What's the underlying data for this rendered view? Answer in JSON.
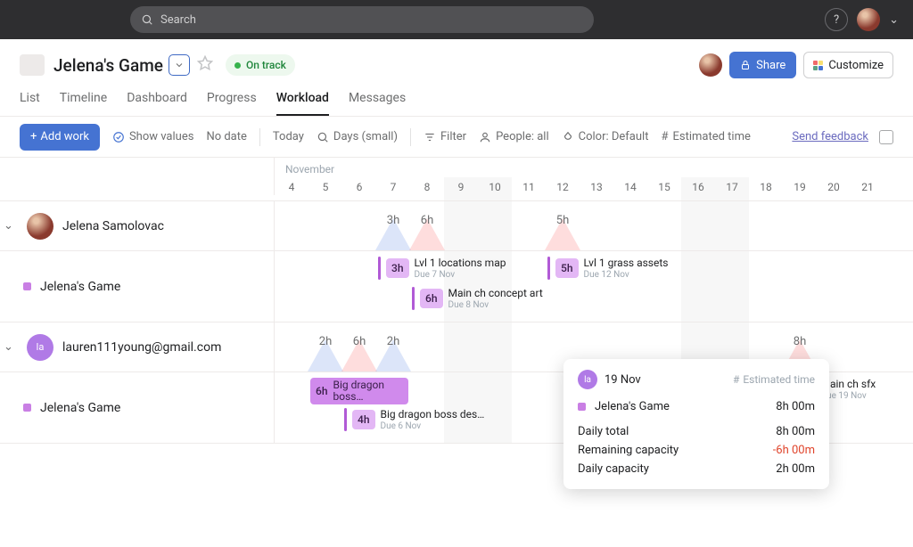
{
  "search": {
    "placeholder": "Search"
  },
  "header": {
    "title": "Jelena's Game",
    "status_label": "On track",
    "share_label": "Share",
    "customize_label": "Customize"
  },
  "tabs": [
    "List",
    "Timeline",
    "Dashboard",
    "Progress",
    "Workload",
    "Messages"
  ],
  "active_tab": 4,
  "toolbar": {
    "add_work": "Add work",
    "show_values": "Show values",
    "no_date": "No date",
    "today": "Today",
    "zoom": "Days (small)",
    "filter": "Filter",
    "people": "People: all",
    "color": "Color: Default",
    "estimate": "Estimated time",
    "feedback": "Send feedback"
  },
  "month": "November",
  "days": [
    "4",
    "5",
    "6",
    "7",
    "8",
    "9",
    "10",
    "11",
    "12",
    "13",
    "14",
    "15",
    "16",
    "17",
    "18",
    "19",
    "20",
    "21"
  ],
  "weekend_indices": [
    5,
    6,
    12,
    13
  ],
  "people": [
    {
      "name": "Jelena Samolovac",
      "avatar": "photo",
      "hours": [
        {
          "day": 7,
          "h": "3h",
          "peak": "blue"
        },
        {
          "day": 8,
          "h": "6h",
          "peak": "red"
        },
        {
          "day": 12,
          "h": "5h",
          "peak": "red"
        }
      ],
      "project_label": "Jelena's Game",
      "tasks": [
        {
          "kind": "card",
          "day": 7,
          "row": 0,
          "hours": "3h",
          "title": "Lvl 1 locations map",
          "due": "Due 7 Nov"
        },
        {
          "kind": "card",
          "day": 12,
          "row": 0,
          "hours": "5h",
          "title": "Lvl 1 grass assets",
          "due": "Due 12 Nov"
        },
        {
          "kind": "card",
          "day": 8,
          "row": 1,
          "hours": "6h",
          "title": "Main ch concept art",
          "due": "Due 8 Nov"
        }
      ]
    },
    {
      "name": "lauren111young@gmail.com",
      "avatar": "la",
      "hours": [
        {
          "day": 5,
          "h": "2h",
          "peak": "blue"
        },
        {
          "day": 6,
          "h": "6h",
          "peak": "red"
        },
        {
          "day": 7,
          "h": "2h",
          "peak": "blue"
        },
        {
          "day": 19,
          "h": "8h",
          "peak": "red"
        }
      ],
      "project_label": "Jelena's Game",
      "tasks": [
        {
          "kind": "bar",
          "start": 5,
          "end": 7,
          "row": 0,
          "hours": "6h",
          "title": "Big dragon boss…"
        },
        {
          "kind": "card",
          "day": 6,
          "row": 1,
          "hours": "4h",
          "title": "Big dragon boss des…",
          "due": "Due 6 Nov"
        },
        {
          "kind": "card",
          "day": 19,
          "row": 0,
          "hours": "8h",
          "title": "Main ch sfx",
          "due": "Due 19 Nov"
        }
      ]
    }
  ],
  "tooltip": {
    "avatar": "la",
    "date": "19 Nov",
    "est_label": "Estimated time",
    "project": "Jelena's Game",
    "project_value": "8h 00m",
    "lines": [
      {
        "label": "Daily total",
        "value": "8h 00m"
      },
      {
        "label": "Remaining capacity",
        "value": "-6h 00m",
        "cls": "tt-red"
      },
      {
        "label": "Daily capacity",
        "value": "2h 00m"
      }
    ]
  },
  "colors": {
    "accent": "#4573d2",
    "purple": "#c97fe4"
  }
}
